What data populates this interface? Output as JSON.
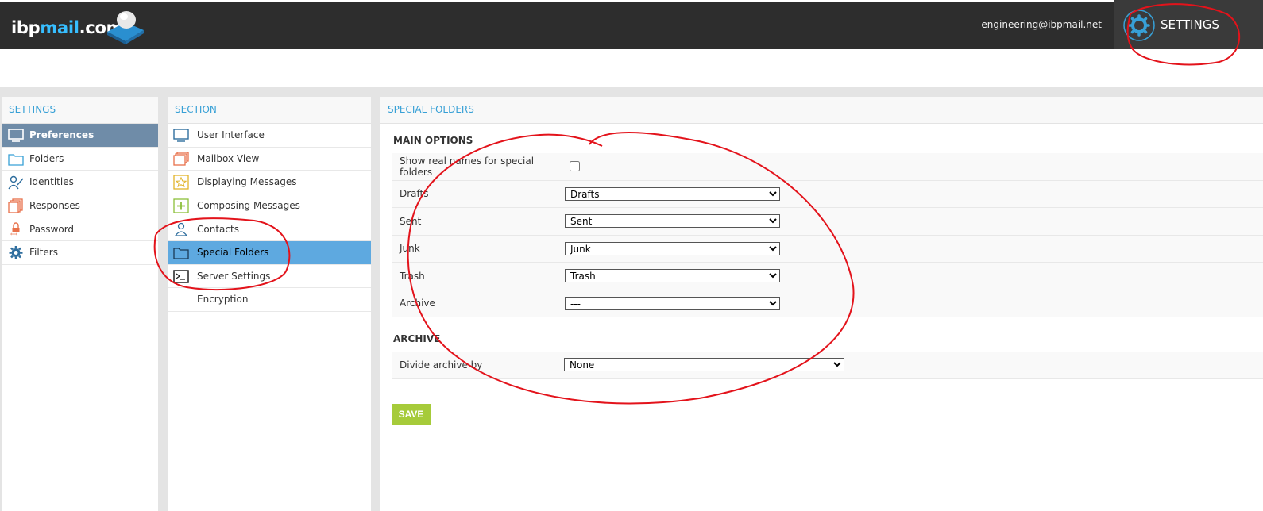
{
  "header": {
    "logo_part1": "ibp",
    "logo_part2": "mail",
    "logo_part3": ".com",
    "user_email": "engineering@ibpmail.net",
    "settings_label": "SETTINGS"
  },
  "settings_panel": {
    "title": "SETTINGS",
    "items": [
      {
        "label": "Preferences",
        "icon": "monitor-icon"
      },
      {
        "label": "Folders",
        "icon": "folder-icon"
      },
      {
        "label": "Identities",
        "icon": "identity-icon"
      },
      {
        "label": "Responses",
        "icon": "responses-icon"
      },
      {
        "label": "Password",
        "icon": "lock-icon"
      },
      {
        "label": "Filters",
        "icon": "gear-icon"
      }
    ]
  },
  "section_panel": {
    "title": "SECTION",
    "items": [
      {
        "label": "User Interface",
        "icon": "monitor-icon"
      },
      {
        "label": "Mailbox View",
        "icon": "mailbox-icon"
      },
      {
        "label": "Displaying Messages",
        "icon": "star-icon"
      },
      {
        "label": "Composing Messages",
        "icon": "plus-icon"
      },
      {
        "label": "Contacts",
        "icon": "contact-icon"
      },
      {
        "label": "Special Folders",
        "icon": "folder-icon"
      },
      {
        "label": "Server Settings",
        "icon": "terminal-icon"
      },
      {
        "label": "Encryption",
        "icon": ""
      }
    ]
  },
  "main": {
    "title": "SPECIAL FOLDERS",
    "main_options_title": "MAIN OPTIONS",
    "show_real_names_label": "Show real names for special folders",
    "show_real_names_checked": false,
    "drafts_label": "Drafts",
    "drafts_value": "Drafts",
    "sent_label": "Sent",
    "sent_value": "Sent",
    "junk_label": "Junk",
    "junk_value": "Junk",
    "trash_label": "Trash",
    "trash_value": "Trash",
    "archive_label": "Archive",
    "archive_value": "---",
    "archive_title": "ARCHIVE",
    "divide_label": "Divide archive by",
    "divide_value": "None",
    "save_label": "SAVE"
  },
  "colors": {
    "topbar": "#2d2d2d",
    "accent": "#37a0d6",
    "settings_selected": "#6f8ca8",
    "section_selected": "#5ea9e0",
    "save_button": "#a6cb3a",
    "annotation": "#e3131b"
  }
}
